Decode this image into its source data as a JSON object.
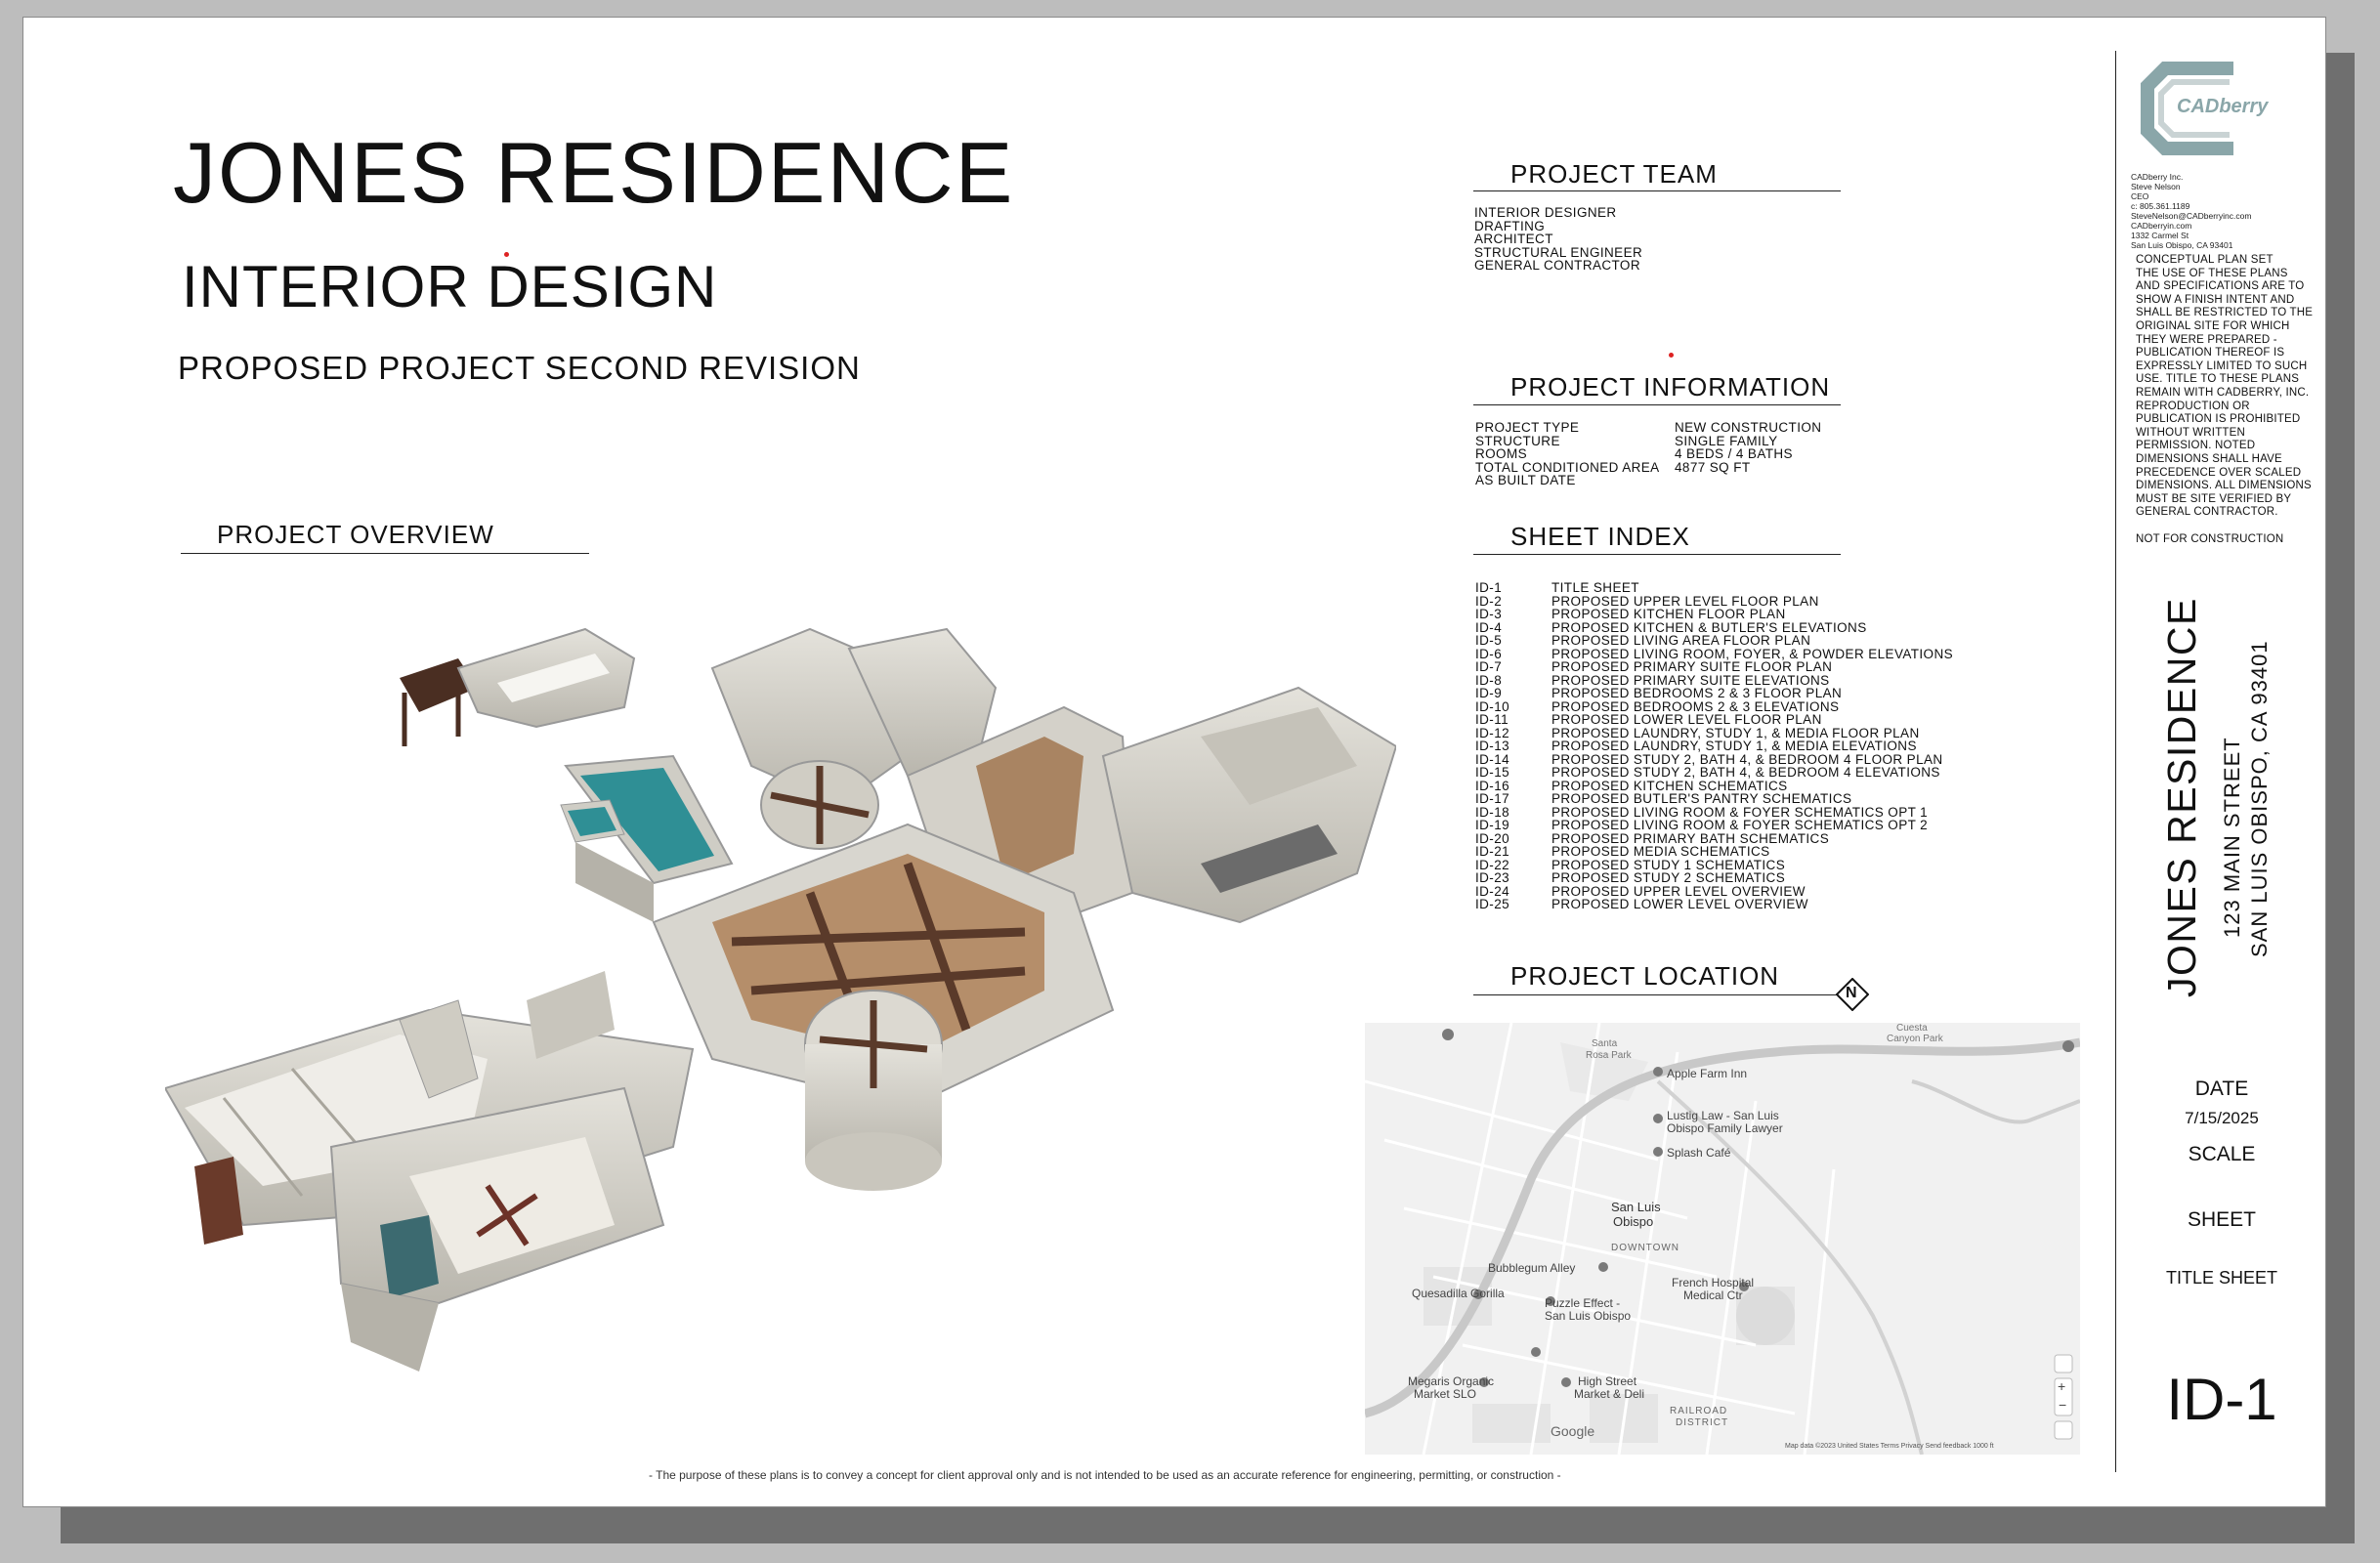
{
  "header": {
    "title": "JONES RESIDENCE",
    "subtitle": "INTERIOR DESIGN",
    "revision": "PROPOSED PROJECT SECOND REVISION"
  },
  "overview": {
    "heading": "PROJECT OVERVIEW"
  },
  "team": {
    "heading": "PROJECT TEAM",
    "roles": [
      "INTERIOR DESIGNER",
      "DRAFTING",
      "ARCHITECT",
      "STRUCTURAL ENGINEER",
      "GENERAL CONTRACTOR"
    ]
  },
  "info": {
    "heading": "PROJECT INFORMATION",
    "rows": [
      {
        "label": "PROJECT TYPE",
        "value": "NEW CONSTRUCTION"
      },
      {
        "label": "STRUCTURE",
        "value": "SINGLE FAMILY"
      },
      {
        "label": "ROOMS",
        "value": "4 BEDS / 4 BATHS"
      },
      {
        "label": "TOTAL CONDITIONED AREA",
        "value": "4877 SQ FT"
      },
      {
        "label": "AS BUILT DATE",
        "value": ""
      }
    ]
  },
  "index": {
    "heading": "SHEET INDEX",
    "rows": [
      {
        "id": "ID-1",
        "name": "TITLE SHEET"
      },
      {
        "id": "ID-2",
        "name": "PROPOSED UPPER LEVEL FLOOR PLAN"
      },
      {
        "id": "ID-3",
        "name": "PROPOSED KITCHEN FLOOR PLAN"
      },
      {
        "id": "ID-4",
        "name": "PROPOSED KITCHEN & BUTLER'S ELEVATIONS"
      },
      {
        "id": "ID-5",
        "name": "PROPOSED LIVING AREA FLOOR PLAN"
      },
      {
        "id": "ID-6",
        "name": "PROPOSED LIVING ROOM, FOYER, & POWDER ELEVATIONS"
      },
      {
        "id": "ID-7",
        "name": "PROPOSED PRIMARY SUITE FLOOR PLAN"
      },
      {
        "id": "ID-8",
        "name": "PROPOSED PRIMARY SUITE ELEVATIONS"
      },
      {
        "id": "ID-9",
        "name": "PROPOSED BEDROOMS 2 & 3 FLOOR PLAN"
      },
      {
        "id": "ID-10",
        "name": "PROPOSED BEDROOMS 2 & 3 ELEVATIONS"
      },
      {
        "id": "ID-11",
        "name": "PROPOSED LOWER LEVEL FLOOR PLAN"
      },
      {
        "id": "ID-12",
        "name": "PROPOSED LAUNDRY, STUDY 1, & MEDIA FLOOR PLAN"
      },
      {
        "id": "ID-13",
        "name": "PROPOSED LAUNDRY, STUDY 1, & MEDIA ELEVATIONS"
      },
      {
        "id": "ID-14",
        "name": "PROPOSED STUDY 2, BATH 4, & BEDROOM 4 FLOOR PLAN"
      },
      {
        "id": "ID-15",
        "name": "PROPOSED STUDY 2, BATH 4, & BEDROOM 4 ELEVATIONS"
      },
      {
        "id": "ID-16",
        "name": "PROPOSED KITCHEN SCHEMATICS"
      },
      {
        "id": "ID-17",
        "name": "PROPOSED BUTLER'S PANTRY SCHEMATICS"
      },
      {
        "id": "ID-18",
        "name": "PROPOSED LIVING ROOM & FOYER SCHEMATICS OPT 1"
      },
      {
        "id": "ID-19",
        "name": "PROPOSED LIVING ROOM & FOYER SCHEMATICS OPT 2"
      },
      {
        "id": "ID-20",
        "name": "PROPOSED PRIMARY BATH SCHEMATICS"
      },
      {
        "id": "ID-21",
        "name": "PROPOSED MEDIA SCHEMATICS"
      },
      {
        "id": "ID-22",
        "name": "PROPOSED STUDY 1 SCHEMATICS"
      },
      {
        "id": "ID-23",
        "name": "PROPOSED STUDY 2 SCHEMATICS"
      },
      {
        "id": "ID-24",
        "name": "PROPOSED UPPER LEVEL OVERVIEW"
      },
      {
        "id": "ID-25",
        "name": "PROPOSED LOWER LEVEL OVERVIEW"
      }
    ]
  },
  "location": {
    "heading": "PROJECT LOCATION",
    "north": "N",
    "map_labels": {
      "apple_farm": "Apple Farm Inn",
      "lustig": "Lustig Law - San Luis",
      "lustig2": "Obispo Family Lawyer",
      "splash": "Splash Café",
      "slo": "San Luis",
      "slo2": "Obispo",
      "downtown": "DOWNTOWN",
      "bubblegum": "Bubblegum Alley",
      "quesadilla": "Quesadilla Gorilla",
      "puzzle": "Puzzle Effect -",
      "puzzle2": "San Luis Obispo",
      "french": "French Hospital",
      "french2": "Medical Ctr",
      "megaris": "Megaris Organic",
      "megaris2": "Market SLO",
      "highstreet": "High Street",
      "highstreet2": "Market & Deli",
      "railroad": "RAILROAD",
      "railroad2": "DISTRICT",
      "santa_rosa": "Santa",
      "santa_rosa2": "Rosa Park",
      "cuesta": "Cuesta",
      "cuesta2": "Canyon Park",
      "google": "Google",
      "footer": "Map data ©2023   United States   Terms   Privacy   Send feedback   1000 ft"
    }
  },
  "disclaimer": "- The purpose of these plans is to convey a concept for client approval only and is not intended to be used as an accurate reference for engineering, permitting, or construction -",
  "titleblock": {
    "logo_text": "CADberry",
    "company_lines": [
      "CADberry Inc.",
      "Steve Nelson",
      "CEO",
      "c: 805.361.1189",
      "SteveNelson@CADberryinc.com",
      "CADberryin.com",
      "1332 Carmel St",
      "San Luis Obispo, CA 93401"
    ],
    "legal_heading": "CONCEPTUAL PLAN SET",
    "legal_body": "The use of these plans and specifications are to show a finish intent and shall be restricted to the original site for which they were prepared - publication thereof is expressly limited to such use. Title to these plans remain with CADberry, Inc. Reproduction or publication is prohibited without written permission. Noted dimensions shall have precedence over scaled dimensions. ALL DIMENSIONS MUST BE SITE VERIFIED BY GENERAL CONTRACTOR.",
    "not_for_construction": "NOT FOR CONSTRUCTION",
    "project_name": "JONES RESIDENCE",
    "street": "123 MAIN STREET",
    "city": "SAN LUIS OBISPO, CA  93401",
    "date_label": "DATE",
    "date_value": "7/15/2025",
    "scale_label": "SCALE",
    "sheet_label": "SHEET",
    "sheet_name": "TITLE SHEET",
    "sheet_number": "ID-1"
  },
  "colors": {
    "pool": "#2f8f95",
    "beam": "#5a3a2a",
    "wall": "#d9d7cf",
    "floor_wood": "#b58e6a",
    "accent_red": "#d22222"
  }
}
